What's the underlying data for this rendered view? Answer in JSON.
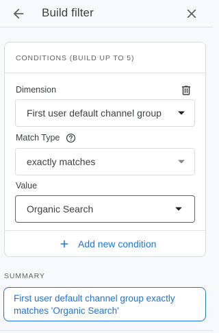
{
  "header": {
    "title": "Build filter",
    "back_icon": "arrow-back-icon",
    "close_icon": "close-icon"
  },
  "conditions": {
    "title": "CONDITIONS (BUILD UP TO 5)",
    "dimension": {
      "label": "Dimension",
      "value": "First user default channel group",
      "delete_icon": "trash-icon"
    },
    "match_type": {
      "label": "Match Type",
      "help_icon": "help-icon",
      "value": "exactly matches"
    },
    "value": {
      "label": "Value",
      "value": "Organic Search"
    },
    "add_condition_label": "Add new condition"
  },
  "summary": {
    "label": "SUMMARY",
    "text": "First user default channel group exactly matches 'Organic Search'"
  },
  "colors": {
    "accent": "#1a73e8",
    "text": "#3c4043",
    "muted": "#5f6368",
    "border": "#dadce0",
    "background": "#f8f9fa"
  }
}
